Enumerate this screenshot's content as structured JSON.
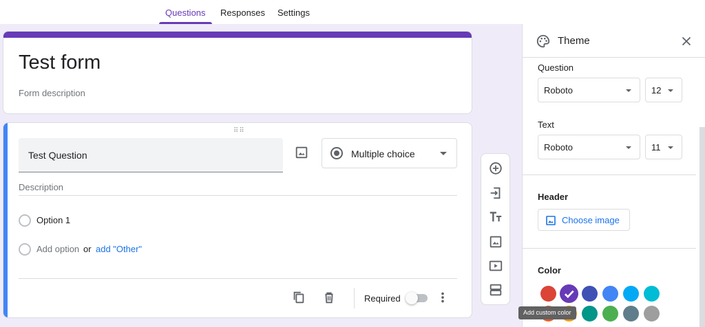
{
  "tabs": [
    {
      "label": "Questions",
      "active": true
    },
    {
      "label": "Responses"
    },
    {
      "label": "Settings"
    }
  ],
  "form": {
    "title": "Test form",
    "description_placeholder": "Form description",
    "accent_color": "#673ab7"
  },
  "question": {
    "title": "Test Question",
    "type_label": "Multiple choice",
    "type_icon": "radio-button-icon",
    "description_placeholder": "Description",
    "options": [
      "Option 1"
    ],
    "add_option_label": "Add option",
    "or_label": "or",
    "add_other_label": "add \"Other\"",
    "required_label": "Required",
    "required_on": false
  },
  "toolbar": {
    "icons": [
      "add-question-icon",
      "import-questions-icon",
      "add-title-icon",
      "add-image-icon",
      "add-video-icon",
      "add-section-icon"
    ]
  },
  "theme_panel": {
    "title": "Theme",
    "question_label": "Question",
    "question_font": "Roboto",
    "question_size": "12",
    "text_label": "Text",
    "text_font": "Roboto",
    "text_size": "11",
    "header_label": "Header",
    "choose_image_label": "Choose image",
    "color_label": "Color",
    "tooltip": "Add custom color",
    "colors_row1": [
      "#db4437",
      "#673ab7",
      "#3f51b5",
      "#4285f4",
      "#03a9f4",
      "#00bcd4"
    ],
    "colors_row2": [
      "#ff5722",
      "#ff9800",
      "#009688",
      "#4caf50",
      "#607d8b",
      "#9e9e9e"
    ],
    "selected_color": "#673ab7"
  }
}
